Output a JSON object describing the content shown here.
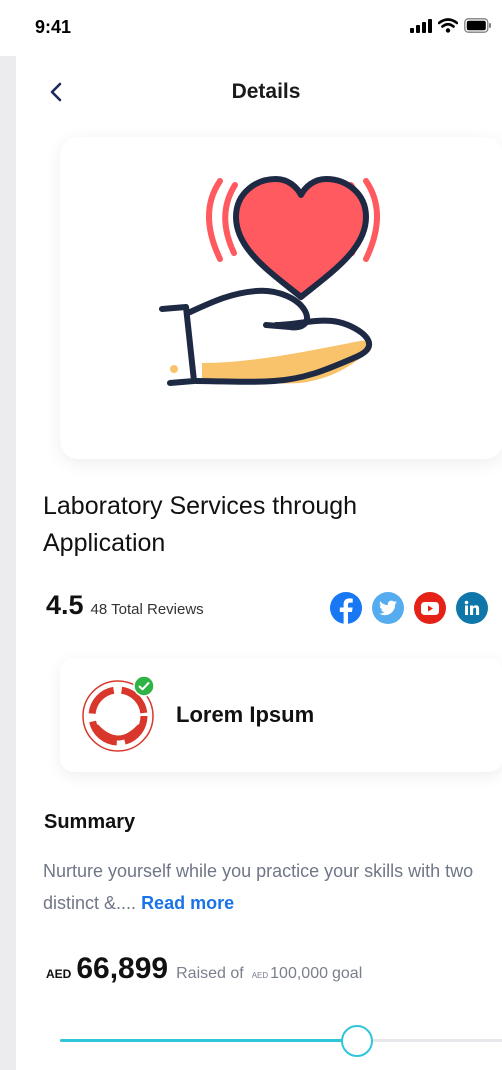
{
  "status_bar": {
    "time": "9:41"
  },
  "header": {
    "title": "Details"
  },
  "hero": {
    "colors": {
      "heart": "#ff5a5f",
      "outline": "#1e2a44",
      "hand_accent": "#f9c36b"
    },
    "icon": "heart-in-hand-icon"
  },
  "headline": "Laboratory Services through Application",
  "rating": {
    "value": "4.5",
    "reviews_label": "48 Total Reviews"
  },
  "socials": [
    {
      "name": "facebook",
      "color": "#1877f2"
    },
    {
      "name": "twitter",
      "color": "#55acee"
    },
    {
      "name": "youtube",
      "color": "#e62117"
    },
    {
      "name": "linkedin",
      "color": "#0e76a8"
    }
  ],
  "organization": {
    "name": "Lorem Ipsum",
    "verified": true,
    "logo_color": "#d9372b",
    "badge_color": "#2fb344"
  },
  "summary": {
    "title": "Summary",
    "text": "Nurture yourself while you practice your skills with two distinct &....",
    "read_more": "Read more"
  },
  "funding": {
    "currency": "AED",
    "raised": "66,899",
    "raised_label": "Raised of",
    "goal_currency": "AED",
    "goal": "100,000",
    "goal_label": "goal",
    "progress": 0.67,
    "accent": "#2ec6d8"
  }
}
